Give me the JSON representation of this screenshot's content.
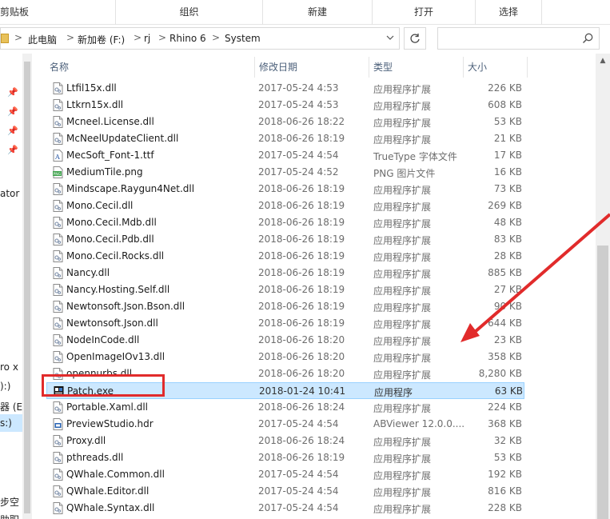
{
  "ribbon": {
    "groups": [
      "剪贴板",
      "组织",
      "新建",
      "打开",
      "选择"
    ]
  },
  "address": {
    "crumbs": [
      "此电脑",
      "新加卷 (F:)",
      "rj",
      "Rhino 6",
      "System"
    ],
    "separator": ">",
    "dropdown_icon": "chevron-down-icon",
    "refresh_icon": "refresh-icon",
    "search_placeholder": "",
    "search_icon": "search-icon"
  },
  "nav": {
    "items": [
      "ator",
      "ro x",
      "):)",
      "器 (E:",
      "s:)",
      "步空",
      "助职"
    ]
  },
  "columns": [
    "名称",
    "修改日期",
    "类型",
    "大小"
  ],
  "files": [
    {
      "name": "Ltfil15x.dll",
      "date": "2017-05-24 4:53",
      "type": "应用程序扩展",
      "size": "226 KB",
      "icon": "dll"
    },
    {
      "name": "Ltkrn15x.dll",
      "date": "2017-05-24 4:53",
      "type": "应用程序扩展",
      "size": "608 KB",
      "icon": "dll"
    },
    {
      "name": "Mcneel.License.dll",
      "date": "2018-06-26 18:22",
      "type": "应用程序扩展",
      "size": "53 KB",
      "icon": "dll"
    },
    {
      "name": "McNeelUpdateClient.dll",
      "date": "2018-06-26 18:19",
      "type": "应用程序扩展",
      "size": "21 KB",
      "icon": "dll"
    },
    {
      "name": "MecSoft_Font-1.ttf",
      "date": "2017-05-24 4:54",
      "type": "TrueType 字体文件",
      "size": "17 KB",
      "icon": "font"
    },
    {
      "name": "MediumTile.png",
      "date": "2017-05-24 4:52",
      "type": "PNG 图片文件",
      "size": "16 KB",
      "icon": "png"
    },
    {
      "name": "Mindscape.Raygun4Net.dll",
      "date": "2018-06-26 18:19",
      "type": "应用程序扩展",
      "size": "73 KB",
      "icon": "dll"
    },
    {
      "name": "Mono.Cecil.dll",
      "date": "2018-06-26 18:19",
      "type": "应用程序扩展",
      "size": "269 KB",
      "icon": "dll"
    },
    {
      "name": "Mono.Cecil.Mdb.dll",
      "date": "2018-06-26 18:19",
      "type": "应用程序扩展",
      "size": "48 KB",
      "icon": "dll"
    },
    {
      "name": "Mono.Cecil.Pdb.dll",
      "date": "2018-06-26 18:19",
      "type": "应用程序扩展",
      "size": "83 KB",
      "icon": "dll"
    },
    {
      "name": "Mono.Cecil.Rocks.dll",
      "date": "2018-06-26 18:19",
      "type": "应用程序扩展",
      "size": "28 KB",
      "icon": "dll"
    },
    {
      "name": "Nancy.dll",
      "date": "2018-06-26 18:19",
      "type": "应用程序扩展",
      "size": "885 KB",
      "icon": "dll"
    },
    {
      "name": "Nancy.Hosting.Self.dll",
      "date": "2018-06-26 18:19",
      "type": "应用程序扩展",
      "size": "27 KB",
      "icon": "dll"
    },
    {
      "name": "Newtonsoft.Json.Bson.dll",
      "date": "2018-06-26 18:19",
      "type": "应用程序扩展",
      "size": "90 KB",
      "icon": "dll"
    },
    {
      "name": "Newtonsoft.Json.dll",
      "date": "2018-06-26 18:19",
      "type": "应用程序扩展",
      "size": "644 KB",
      "icon": "dll"
    },
    {
      "name": "NodeInCode.dll",
      "date": "2018-06-26 18:20",
      "type": "应用程序扩展",
      "size": "23 KB",
      "icon": "dll"
    },
    {
      "name": "OpenImageIOv13.dll",
      "date": "2018-06-26 18:20",
      "type": "应用程序扩展",
      "size": "358 KB",
      "icon": "dll"
    },
    {
      "name": "opennurbs.dll",
      "date": "2018-06-26 18:20",
      "type": "应用程序扩展",
      "size": "8,280 KB",
      "icon": "dll"
    },
    {
      "name": "Patch.exe",
      "date": "2018-01-24 10:41",
      "type": "应用程序",
      "size": "63 KB",
      "icon": "exe",
      "selected": true
    },
    {
      "name": "Portable.Xaml.dll",
      "date": "2018-06-26 18:24",
      "type": "应用程序扩展",
      "size": "224 KB",
      "icon": "dll"
    },
    {
      "name": "PreviewStudio.hdr",
      "date": "2017-05-24 4:54",
      "type": "ABViewer 12.0.0....",
      "size": "368 KB",
      "icon": "hdr"
    },
    {
      "name": "Proxy.dll",
      "date": "2018-06-26 18:24",
      "type": "应用程序扩展",
      "size": "32 KB",
      "icon": "dll"
    },
    {
      "name": "pthreads.dll",
      "date": "2018-06-26 18:19",
      "type": "应用程序扩展",
      "size": "53 KB",
      "icon": "dll"
    },
    {
      "name": "QWhale.Common.dll",
      "date": "2017-05-24 4:54",
      "type": "应用程序扩展",
      "size": "192 KB",
      "icon": "dll"
    },
    {
      "name": "QWhale.Editor.dll",
      "date": "2017-05-24 4:54",
      "type": "应用程序扩展",
      "size": "816 KB",
      "icon": "dll"
    },
    {
      "name": "QWhale.Syntax.dll",
      "date": "2017-05-24 4:54",
      "type": "应用程序扩展",
      "size": "228 KB",
      "icon": "dll"
    }
  ],
  "colors": {
    "selection_bg": "#cce8ff",
    "selection_border": "#99d1ff",
    "annotation": "#e12b2b",
    "header_text": "#4c607a"
  }
}
